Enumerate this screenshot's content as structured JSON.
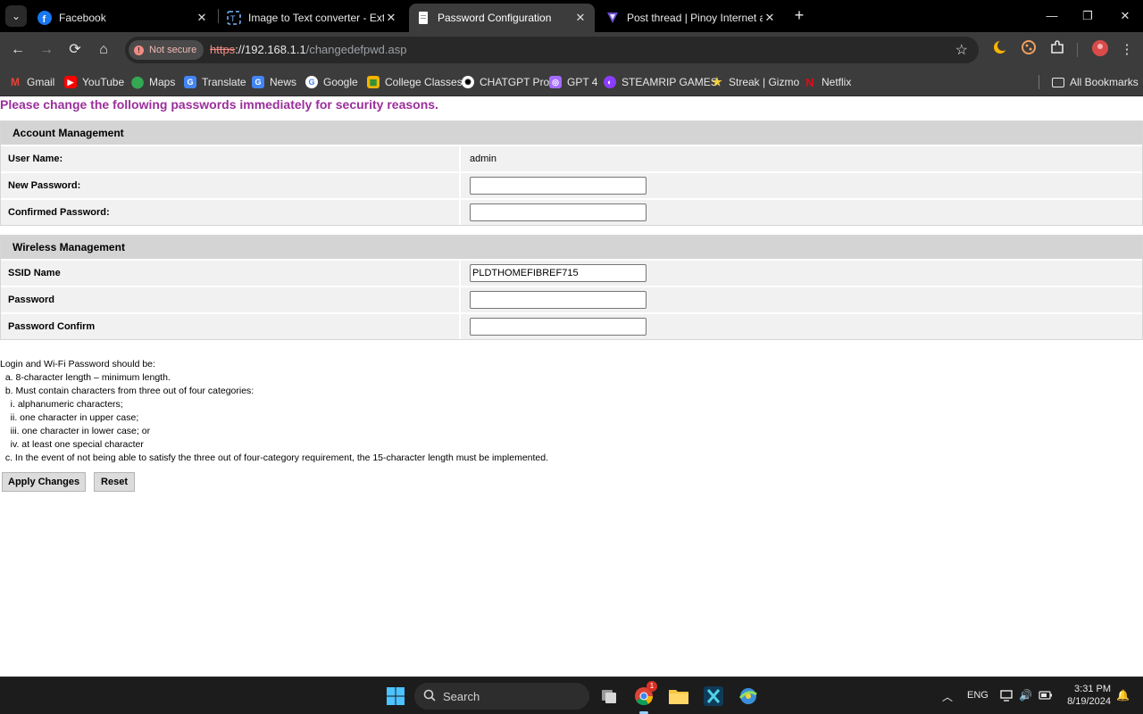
{
  "browser": {
    "tabs": [
      {
        "title": "Facebook",
        "active": false
      },
      {
        "title": "Image to Text converter - Extrac",
        "active": false
      },
      {
        "title": "Password Configuration",
        "active": true
      },
      {
        "title": "Post thread | Pinoy Internet and",
        "active": false
      }
    ],
    "security_chip": "Not secure",
    "url": {
      "scheme": "https",
      "host": "://192.168.1.1",
      "path": "/changedefpwd.asp"
    },
    "bookmarks": [
      {
        "label": "Gmail",
        "icon": "gmail-icon",
        "color": "#ea4335"
      },
      {
        "label": "YouTube",
        "icon": "youtube-icon",
        "color": "#ff0000"
      },
      {
        "label": "Maps",
        "icon": "maps-icon",
        "color": "#34a853"
      },
      {
        "label": "Translate",
        "icon": "translate-icon",
        "color": "#4285f4"
      },
      {
        "label": "News",
        "icon": "news-icon",
        "color": "#4285f4"
      },
      {
        "label": "Google",
        "icon": "google-icon",
        "color": "#ffffff"
      },
      {
        "label": "College Classes",
        "icon": "classroom-icon",
        "color": "#f4b400"
      },
      {
        "label": "CHATGPT Pro",
        "icon": "chatgpt-icon",
        "color": "#ffffff"
      },
      {
        "label": "GPT 4",
        "icon": "gpt4-icon",
        "color": "#a66cff"
      },
      {
        "label": "STEAMRIP GAMES",
        "icon": "steamrip-icon",
        "color": "#8b3dff"
      },
      {
        "label": "Streak | Gizmo",
        "icon": "star-icon",
        "color": "#f4d03f"
      },
      {
        "label": "Netflix",
        "icon": "netflix-icon",
        "color": "#e50914"
      }
    ],
    "all_bookmarks": "All Bookmarks"
  },
  "page": {
    "alert": "Please change the following passwords immediately for security reasons.",
    "account": {
      "heading": "Account Management",
      "user_label": "User Name:",
      "user_value": "admin",
      "new_pw_label": "New Password:",
      "new_pw_value": "",
      "confirm_pw_label": "Confirmed Password:",
      "confirm_pw_value": ""
    },
    "wireless": {
      "heading": "Wireless Management",
      "ssid_label": "SSID Name",
      "ssid_value": "PLDTHOMEFIBREF715",
      "pw_label": "Password",
      "pw_value": "",
      "pw_confirm_label": "Password Confirm",
      "pw_confirm_value": ""
    },
    "rules": [
      "Login and Wi-Fi Password should be:",
      "  a. 8-character length – minimum length.",
      "  b. Must contain characters from three out of four categories:",
      "    i. alphanumeric characters;",
      "    ii. one character in upper case;",
      "    iii. one character in lower case; or",
      "    iv. at least one special character",
      "  c. In the event of not being able to satisfy the three out of four-category requirement, the 15-character length must be implemented."
    ],
    "apply_label": "Apply Changes",
    "reset_label": "Reset"
  },
  "taskbar": {
    "search_label": "Search",
    "language": "ENG",
    "time": "3:31 PM",
    "date": "8/19/2024",
    "notification_badge": "1"
  }
}
